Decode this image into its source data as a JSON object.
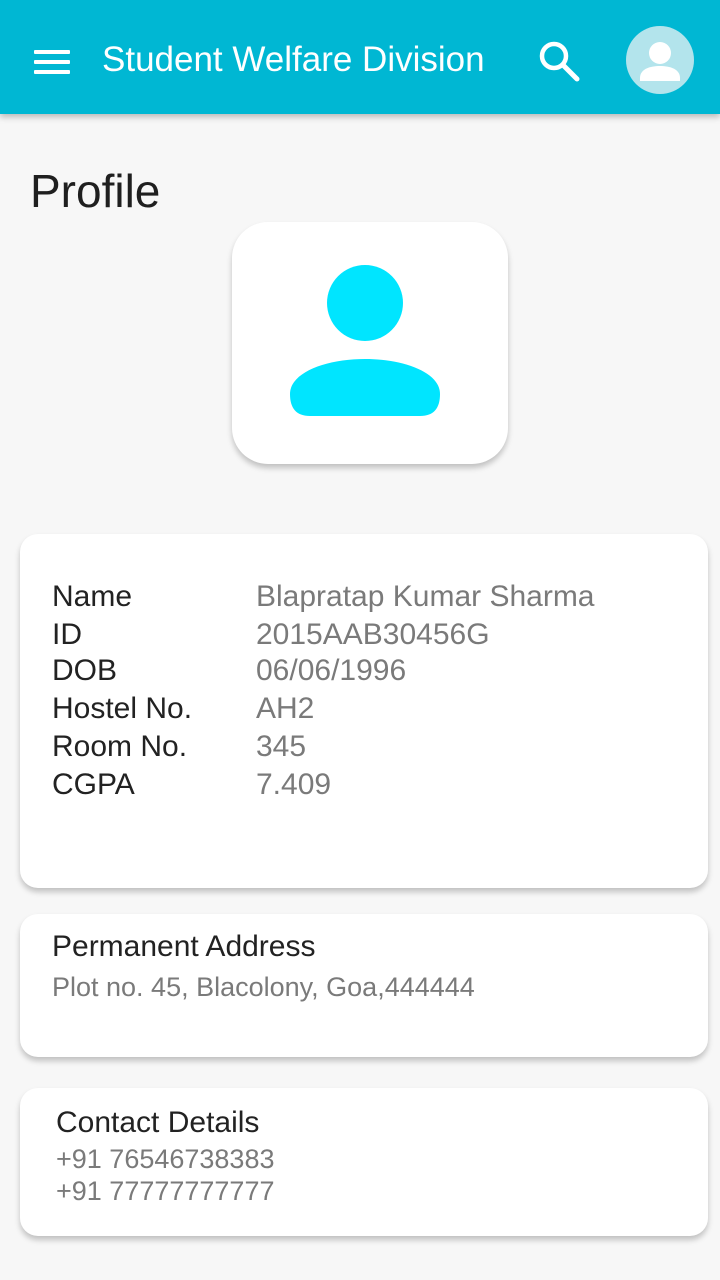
{
  "app_bar": {
    "title": "Student Welfare Division",
    "menu_icon": "hamburger-menu-icon",
    "search_icon": "search-icon",
    "avatar_icon": "account-avatar-icon",
    "color": "#00b7d3"
  },
  "page": {
    "title": "Profile",
    "photo_icon": "person-placeholder-icon",
    "accent": "#00e5ff"
  },
  "details": [
    {
      "label": "Name",
      "value": "Blapratap Kumar Sharma"
    },
    {
      "label": "ID",
      "value": "2015AAB30456G"
    },
    {
      "label": "DOB",
      "value": "06/06/1996"
    },
    {
      "label": "Hostel No.",
      "value": "AH2"
    },
    {
      "label": "Room No.",
      "value": "345"
    },
    {
      "label": "CGPA",
      "value": "7.409"
    }
  ],
  "address": {
    "title": "Permanent Address",
    "text": "Plot no. 45, Blacolony, Goa,444444"
  },
  "contact": {
    "title": "Contact Details",
    "phones": [
      "+91 76546738383",
      "+91 77777777777"
    ]
  }
}
